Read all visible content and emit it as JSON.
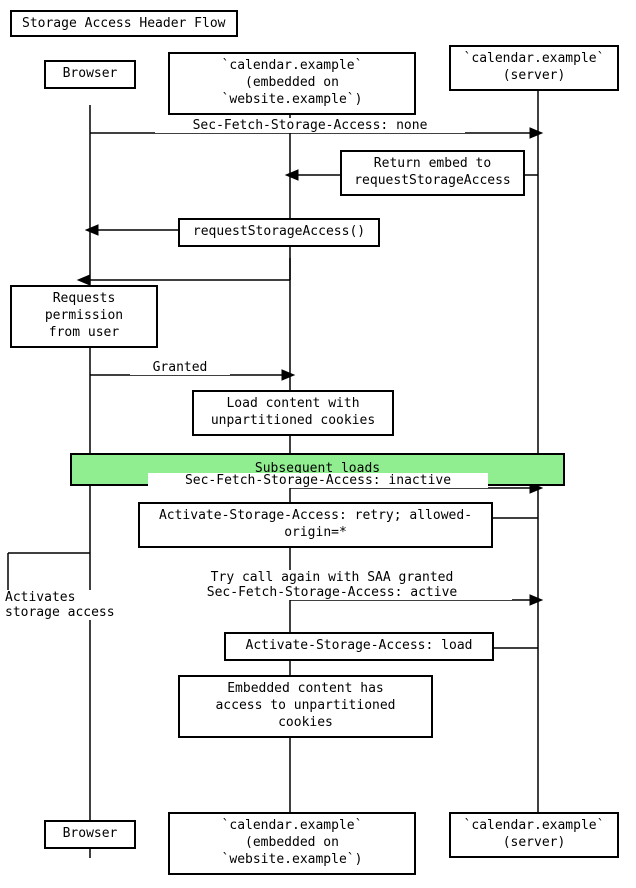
{
  "title": "Storage Access Header Flow",
  "actors": {
    "browser_label": "Browser",
    "embed_label": "`calendar.example`\n(embedded on `website.example`)",
    "server_label": "`calendar.example`\n(server)"
  },
  "boxes": [
    {
      "id": "title",
      "text": "Storage Access Header Flow"
    },
    {
      "id": "browser_top",
      "text": "Browser"
    },
    {
      "id": "embed_top",
      "text": "`calendar.example`\n(embedded on `website.example`)"
    },
    {
      "id": "server_top",
      "text": "`calendar.example`\n(server)"
    },
    {
      "id": "sec_fetch_none",
      "text": "Sec-Fetch-Storage-Access: none"
    },
    {
      "id": "return_embed",
      "text": "Return embed to\nrequestStorageAccess"
    },
    {
      "id": "request_storage",
      "text": "requestStorageAccess()"
    },
    {
      "id": "requests_permission",
      "text": "Requests permission\nfrom user"
    },
    {
      "id": "granted",
      "text": "Granted"
    },
    {
      "id": "load_content",
      "text": "Load content with\nunpartitioned cookies"
    },
    {
      "id": "subsequent_loads",
      "text": "Subsequent loads"
    },
    {
      "id": "sec_fetch_inactive",
      "text": "Sec-Fetch-Storage-Access: inactive"
    },
    {
      "id": "activate_retry",
      "text": "Activate-Storage-Access: retry; allowed-origin=*"
    },
    {
      "id": "activates_storage",
      "text": "Activates storage access"
    },
    {
      "id": "try_call_again",
      "text": "Try call again with SAA granted\nSec-Fetch-Storage-Access: active"
    },
    {
      "id": "activate_load",
      "text": "Activate-Storage-Access: load"
    },
    {
      "id": "embedded_content",
      "text": "Embedded content has\naccess to unpartitioned cookies"
    },
    {
      "id": "browser_bot",
      "text": "Browser"
    },
    {
      "id": "embed_bot",
      "text": "`calendar.example`\n(embedded on `website.example`)"
    },
    {
      "id": "server_bot",
      "text": "`calendar.example`\n(server)"
    }
  ]
}
